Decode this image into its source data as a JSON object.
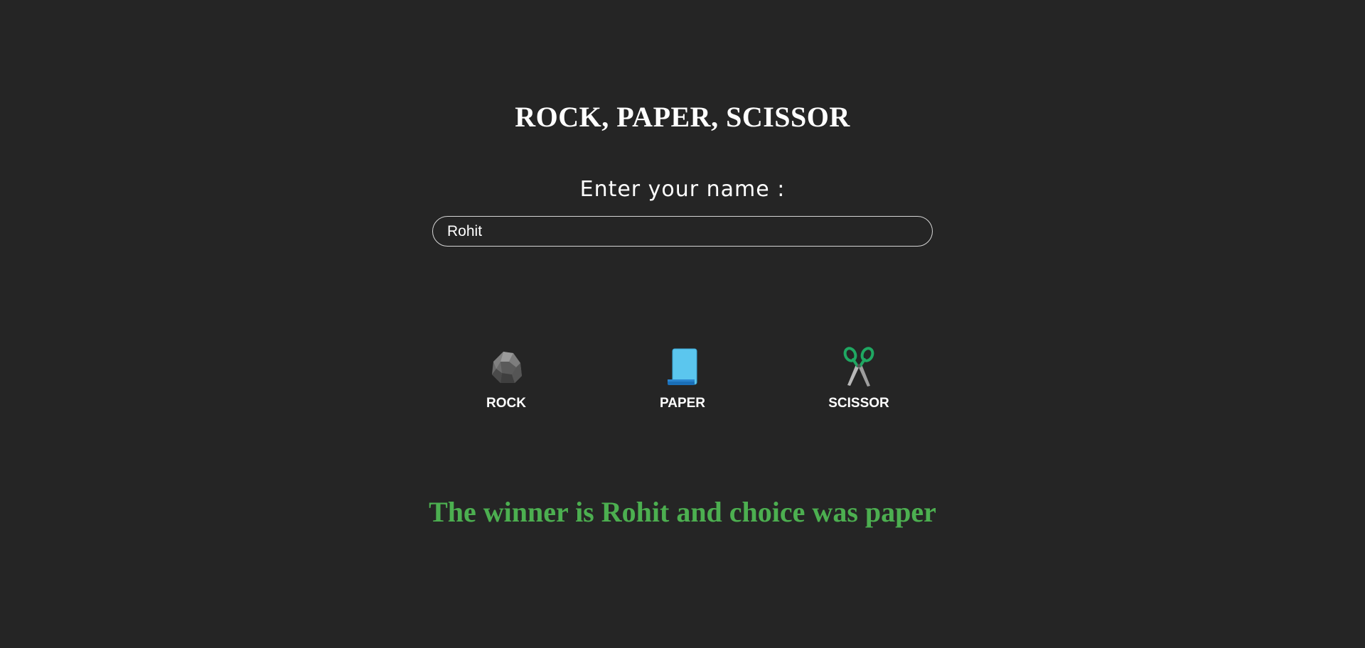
{
  "game": {
    "title": "ROCK, PAPER, SCISSOR",
    "name_label": "Enter your name :",
    "name_value": "Rohit",
    "choices": [
      {
        "label": "ROCK",
        "icon": "rock-icon"
      },
      {
        "label": "PAPER",
        "icon": "paper-scroll-icon"
      },
      {
        "label": "SCISSOR",
        "icon": "scissors-icon"
      }
    ],
    "result": "The winner is Rohit and choice was paper"
  },
  "colors": {
    "background": "#252525",
    "text": "#ffffff",
    "winner": "#4caf50",
    "input_border": "#d6d6d6"
  }
}
